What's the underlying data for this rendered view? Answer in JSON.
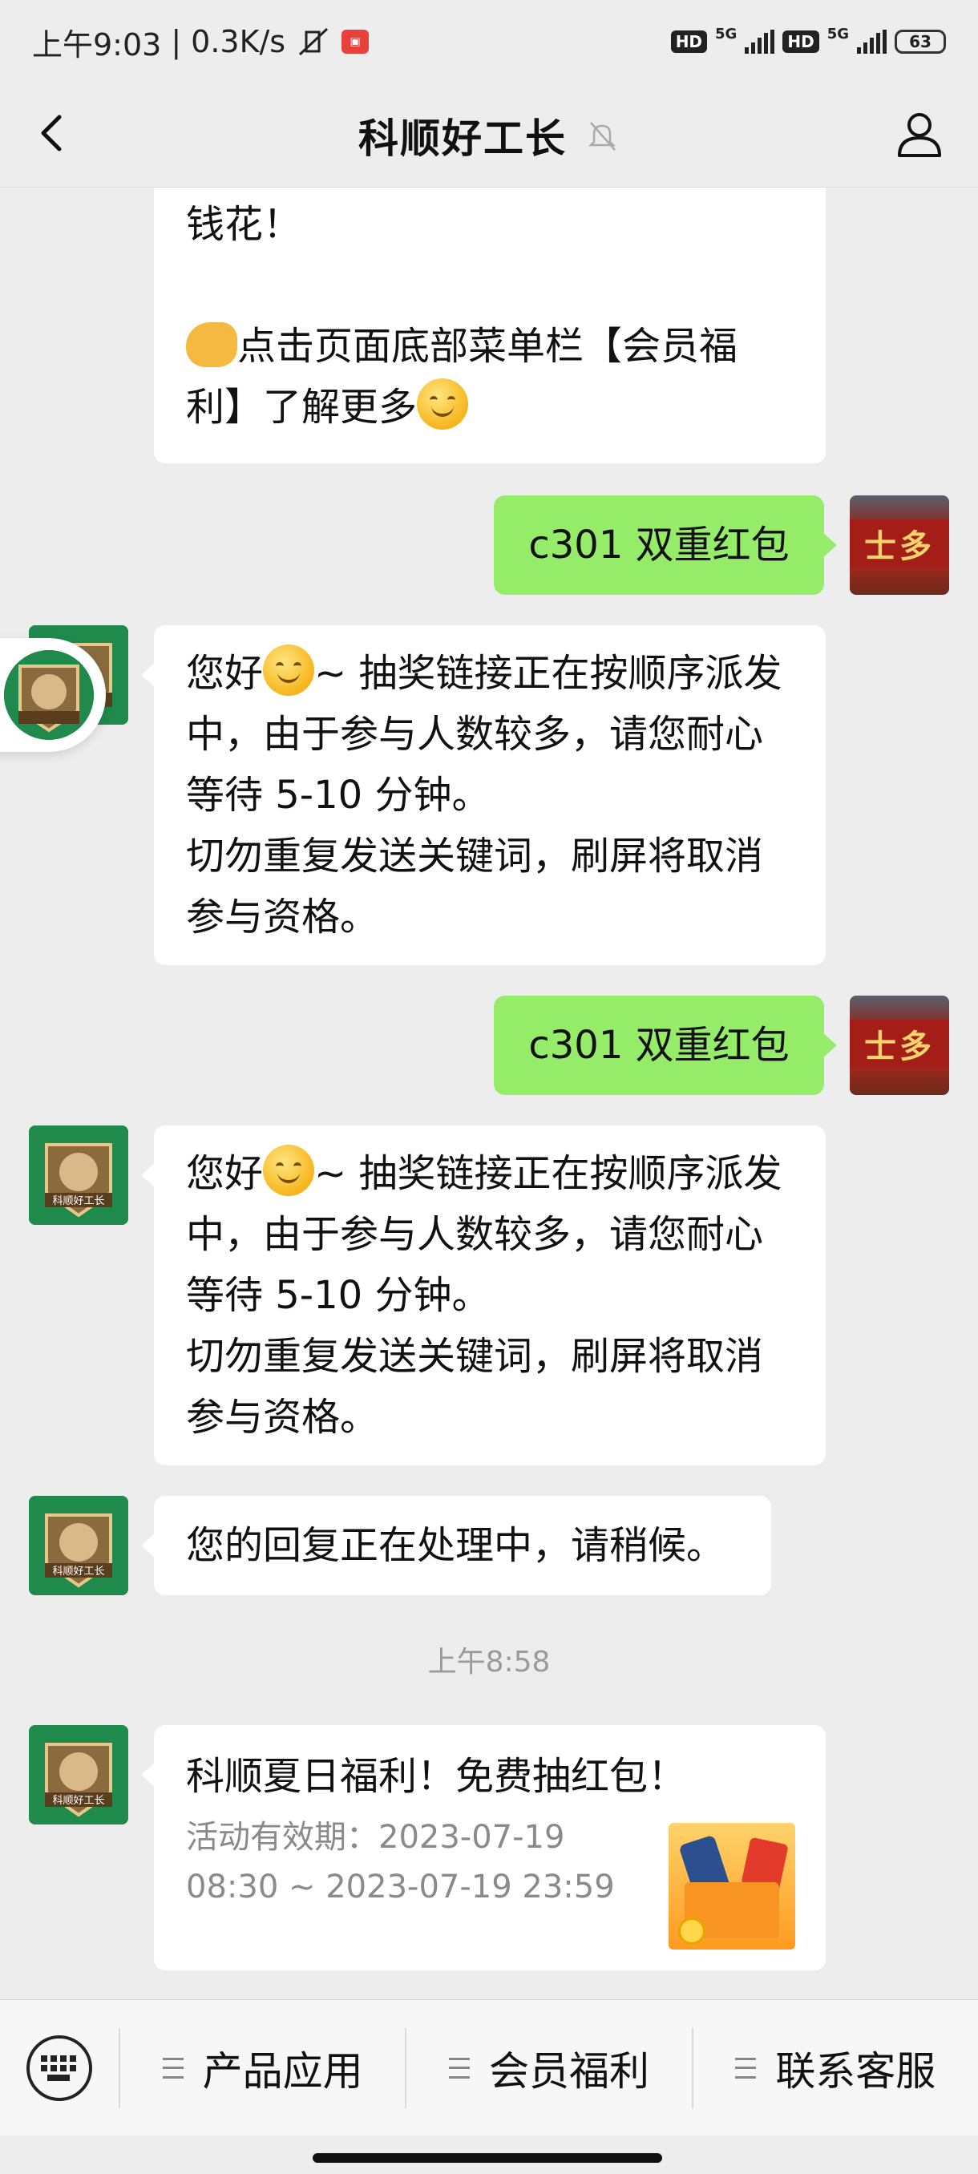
{
  "status_bar": {
    "time": "上午9:03",
    "speed": "0.3K/s",
    "hd1": "HD",
    "net1": "5G",
    "hd2": "HD",
    "net2": "5G",
    "battery": "63"
  },
  "header": {
    "title": "科顺好工长"
  },
  "avatar_label": "科顺好工长",
  "user_avatar_sign": "士多",
  "messages": {
    "partial_top_line1": "钱花！",
    "partial_top_line2": "点击页面底部菜单栏【会员福",
    "partial_top_line3": "利】了解更多",
    "user_msg_1": "c301 双重红包",
    "reply_1": {
      "l1a": "您好",
      "l1b": "~ 抽奖链接正在按顺序派发",
      "l2": "中，由于参与人数较多，请您耐心",
      "l3": "等待 5-10 分钟。",
      "l4": "切勿重复发送关键词，刷屏将取消",
      "l5": "参与资格。"
    },
    "user_msg_2": "c301 双重红包",
    "reply_2": {
      "l1a": "您好",
      "l1b": "~ 抽奖链接正在按顺序派发",
      "l2": "中，由于参与人数较多，请您耐心",
      "l3": "等待 5-10 分钟。",
      "l4": "切勿重复发送关键词，刷屏将取消",
      "l5": "参与资格。"
    },
    "processing": "您的回复正在处理中，请稍候。",
    "timestamp": "上午8:58",
    "card": {
      "title": "科顺夏日福利！免费抽红包！",
      "line1": "活动有效期：2023-07-19",
      "line2": "08:30 ~ 2023-07-19 23:59"
    }
  },
  "menu": {
    "item1": "产品应用",
    "item2": "会员福利",
    "item3": "联系客服"
  }
}
